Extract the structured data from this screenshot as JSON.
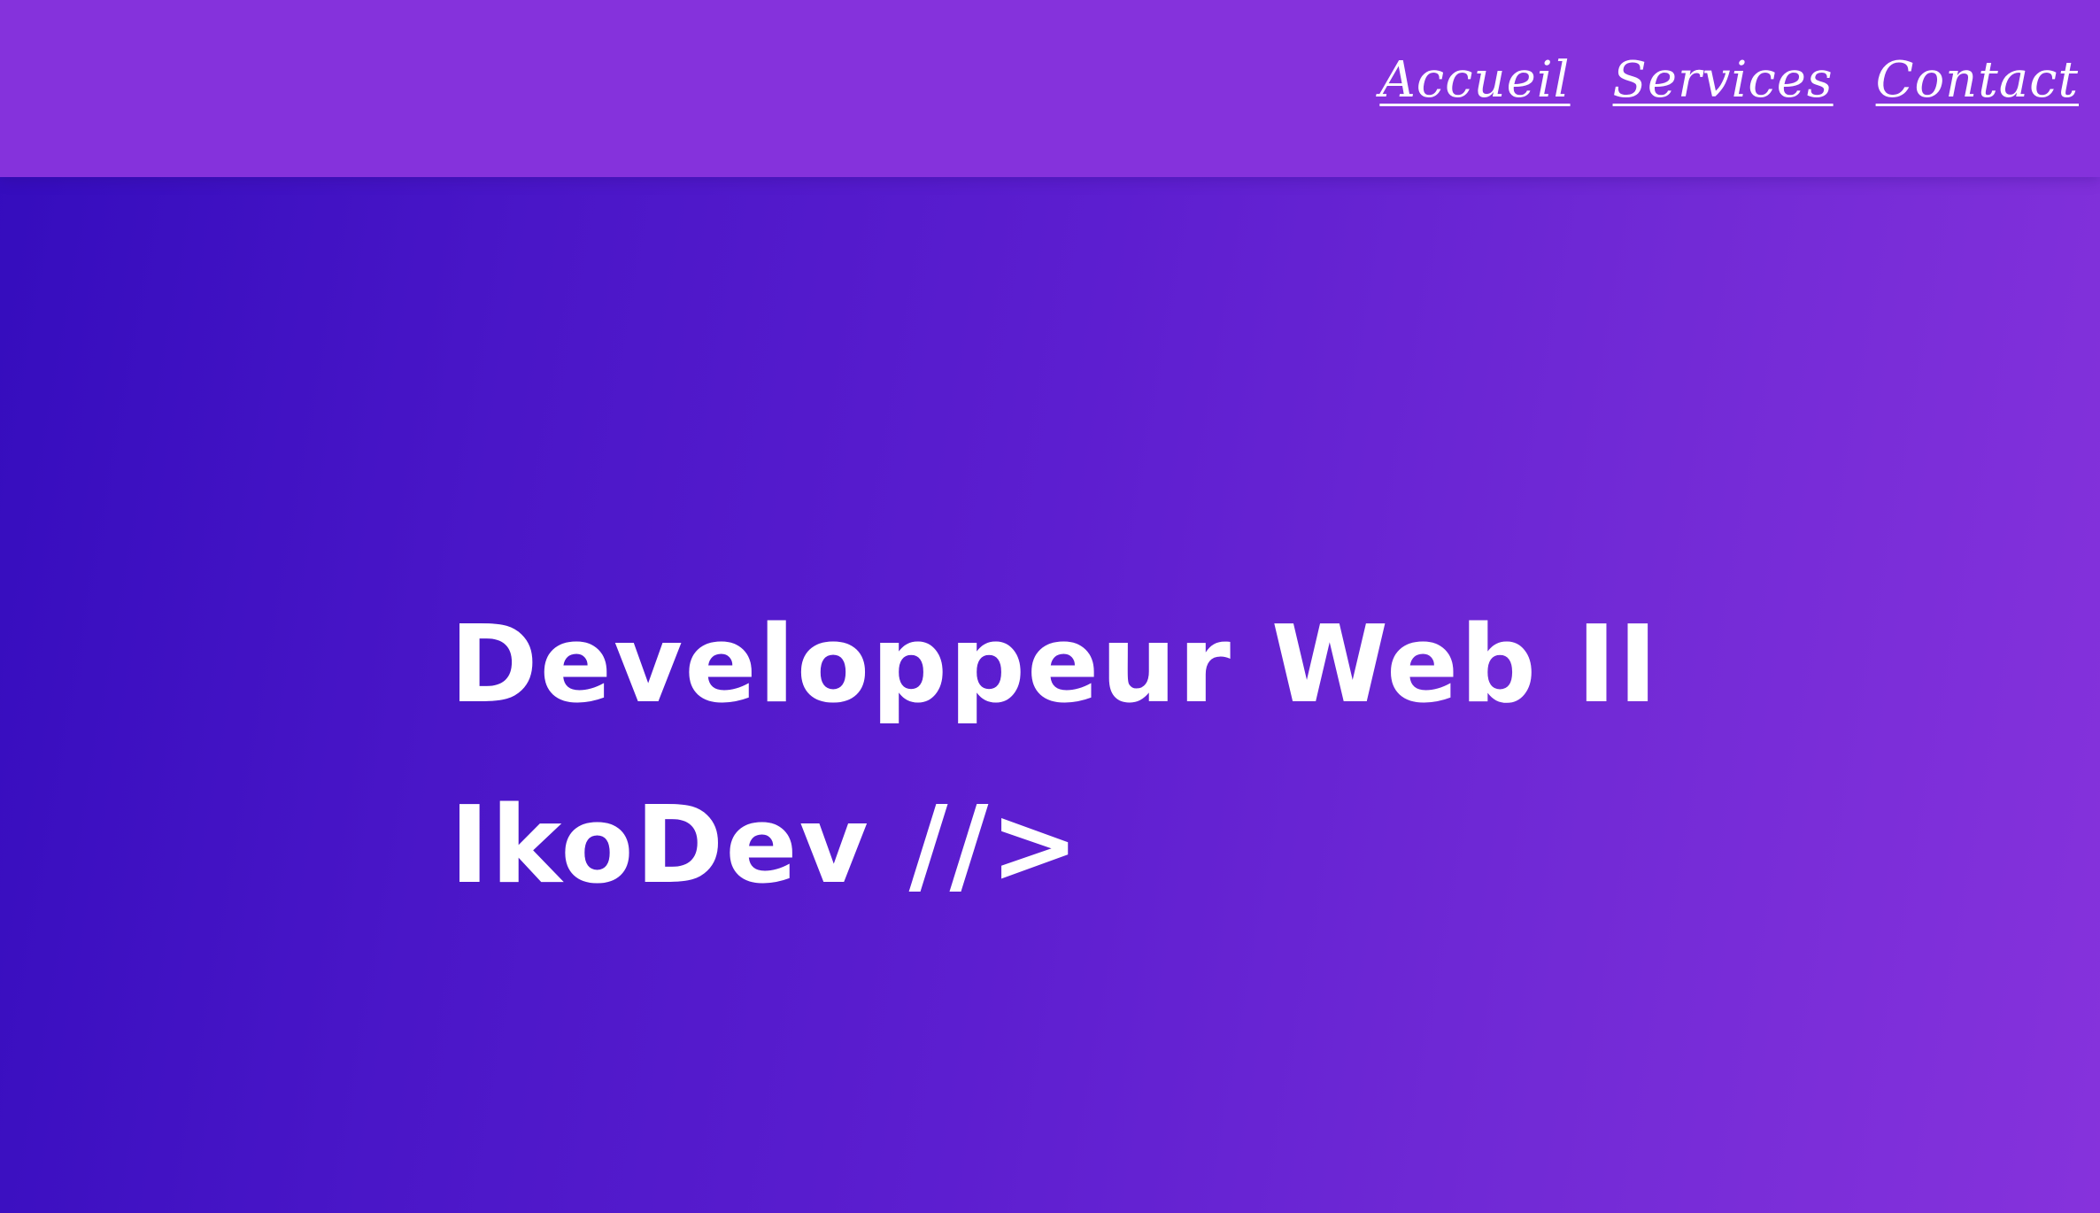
{
  "nav": {
    "items": [
      {
        "label": "Accueil"
      },
      {
        "label": "Services"
      },
      {
        "label": "Contact"
      }
    ]
  },
  "hero": {
    "title_line1": "Developpeur Web II",
    "title_line2": "IkoDev //>"
  },
  "colors": {
    "navbar": "#8532dc",
    "gradient_start": "#340cbd",
    "gradient_end": "#8632dc",
    "text": "#ffffff"
  }
}
